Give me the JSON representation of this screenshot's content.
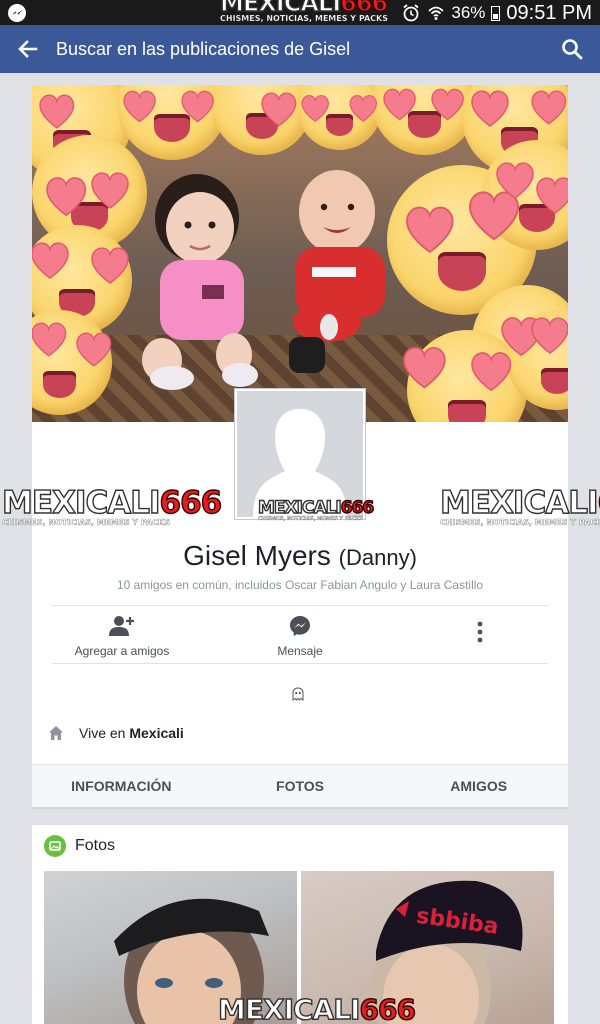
{
  "status_bar": {
    "battery": "36%",
    "time": "09:51 PM"
  },
  "toolbar": {
    "title": "Buscar en las publicaciones de Gisel"
  },
  "watermark": {
    "word1": "MEXICALI",
    "word2": "666",
    "tagline": "CHISMES, NOTICIAS, MEMES Y PACKS"
  },
  "profile": {
    "name": "Gisel Myers",
    "nickname": "(Danny)",
    "mutual_friends": "10 amigos en común, incluidos Oscar Fabian Angulo y Laura Castillo",
    "actions": [
      {
        "label": "Agregar a amigos",
        "icon": "add-friend-icon"
      },
      {
        "label": "Mensaje",
        "icon": "messenger-icon"
      },
      {
        "label": "",
        "icon": "more-icon"
      }
    ],
    "lives_prefix": "Vive en",
    "lives_city": "Mexicali"
  },
  "tabs": [
    "INFORMACIÓN",
    "FOTOS",
    "AMIGOS"
  ],
  "photos": {
    "title": "Fotos"
  },
  "colors": {
    "brand_blue": "#3b5998",
    "status_bar": "#1a1a1a",
    "watermark_red": "#e02020"
  }
}
